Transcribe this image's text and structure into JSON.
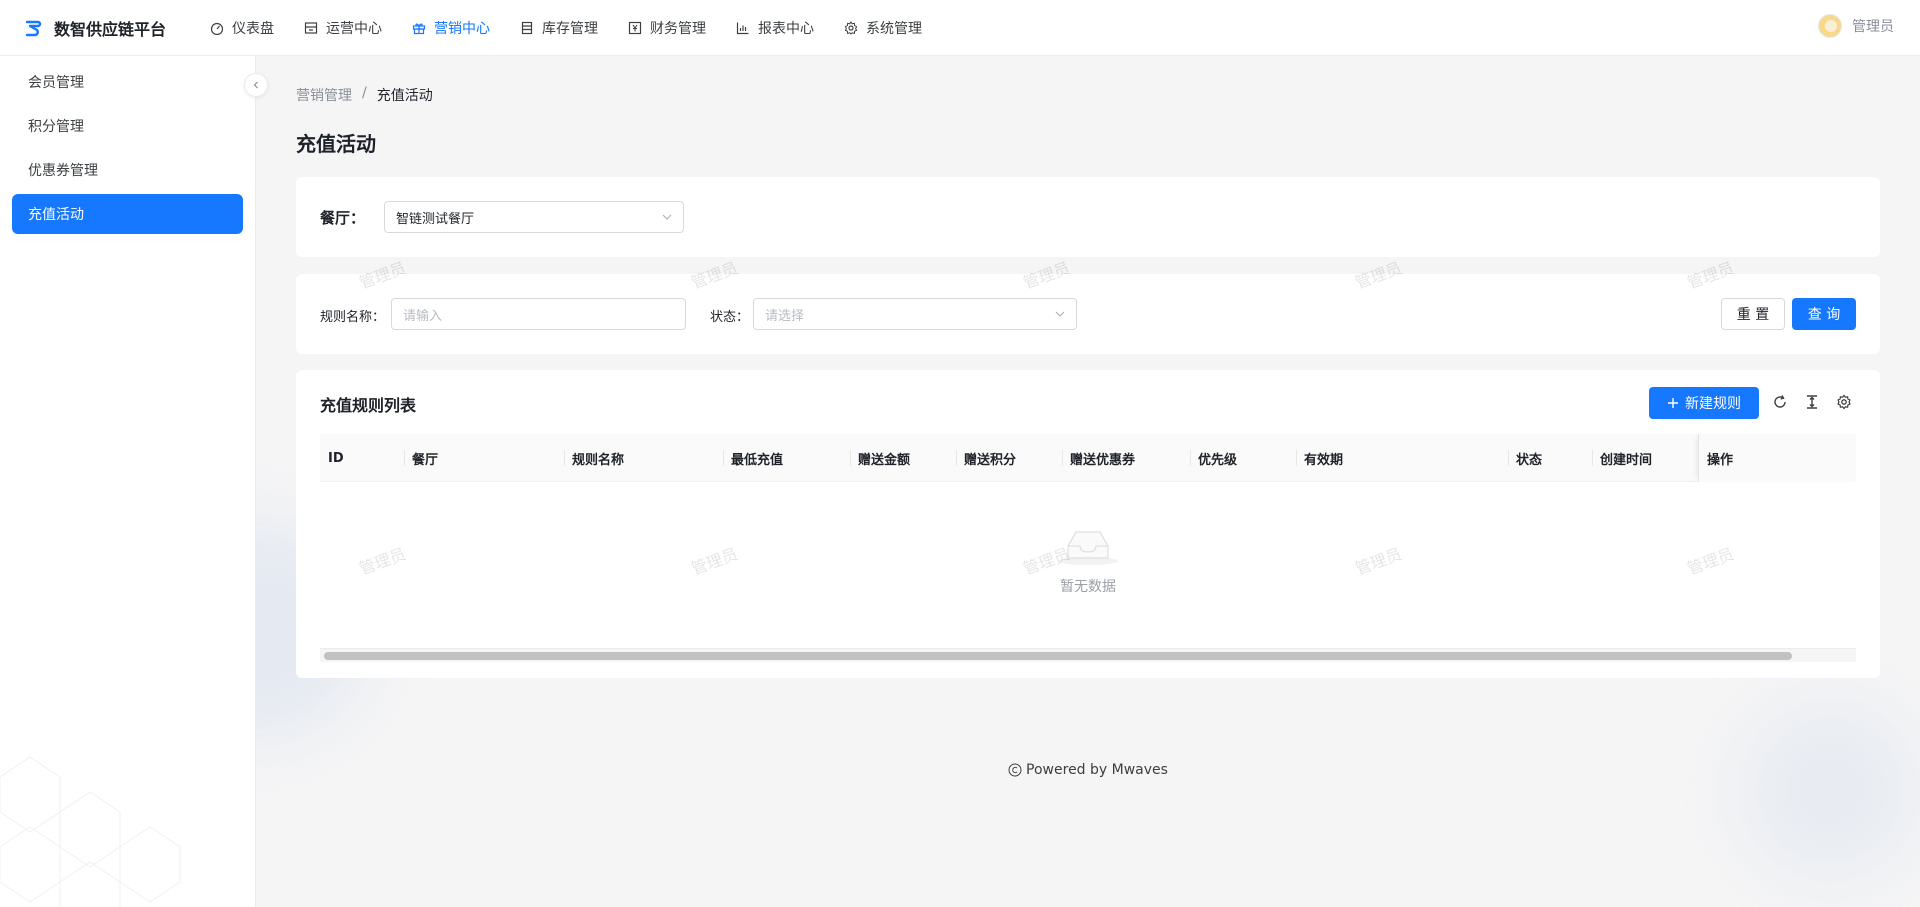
{
  "brand": {
    "name": "数智供应链平台"
  },
  "topnav": [
    {
      "label": "仪表盘",
      "icon": "dashboard-icon",
      "active": false
    },
    {
      "label": "运营中心",
      "icon": "store-icon",
      "active": false
    },
    {
      "label": "营销中心",
      "icon": "gift-icon",
      "active": true
    },
    {
      "label": "库存管理",
      "icon": "inventory-icon",
      "active": false
    },
    {
      "label": "财务管理",
      "icon": "finance-icon",
      "active": false
    },
    {
      "label": "报表中心",
      "icon": "chart-icon",
      "active": false
    },
    {
      "label": "系统管理",
      "icon": "gear-icon",
      "active": false
    }
  ],
  "user": {
    "name": "管理员"
  },
  "sidebar": {
    "items": [
      {
        "label": "会员管理",
        "active": false
      },
      {
        "label": "积分管理",
        "active": false
      },
      {
        "label": "优惠券管理",
        "active": false
      },
      {
        "label": "充值活动",
        "active": true
      }
    ]
  },
  "breadcrumb": {
    "parent": "营销管理",
    "separator": "/",
    "current": "充值活动"
  },
  "page": {
    "title": "充值活动"
  },
  "restaurant": {
    "label": "餐厅：",
    "value": "智链测试餐厅"
  },
  "filter": {
    "rule_name_label": "规则名称：",
    "rule_name_placeholder": "请输入",
    "status_label": "状态：",
    "status_placeholder": "请选择",
    "reset_label": "重 置",
    "query_label": "查 询"
  },
  "table": {
    "title": "充值规则列表",
    "new_button_label": "新建规则",
    "columns": [
      "ID",
      "餐厅",
      "规则名称",
      "最低充值",
      "赠送金额",
      "赠送积分",
      "赠送优惠券",
      "优先级",
      "有效期",
      "状态",
      "创建时间",
      "操作"
    ],
    "empty_text": "暂无数据"
  },
  "watermark": "管理员",
  "footer": {
    "text": "Powered by Mwaves"
  },
  "colors": {
    "primary": "#1677ff",
    "text": "#1f2329",
    "muted": "#8a8f99"
  }
}
